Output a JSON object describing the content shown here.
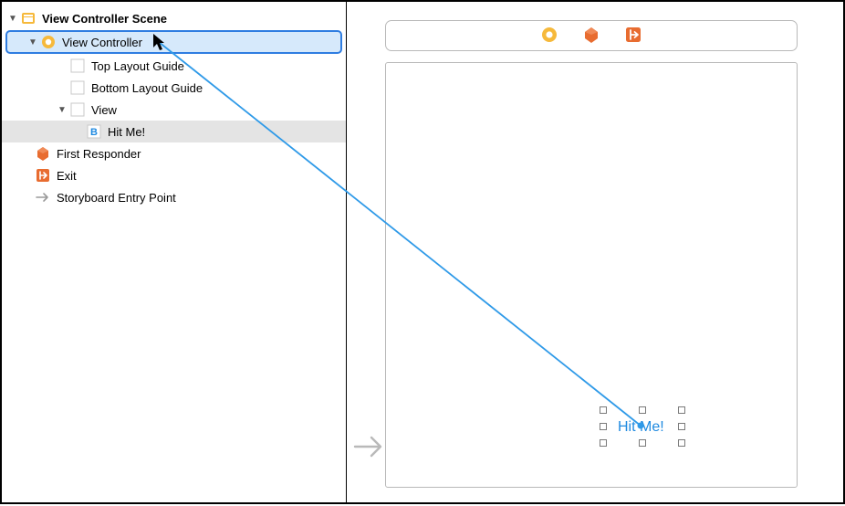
{
  "outline": {
    "scene": {
      "label": "View Controller Scene"
    },
    "viewController": {
      "label": "View Controller"
    },
    "topGuide": {
      "label": "Top Layout Guide"
    },
    "bottomGuide": {
      "label": "Bottom Layout Guide"
    },
    "view": {
      "label": "View"
    },
    "button": {
      "label": "Hit Me!",
      "glyph": "B"
    },
    "firstResponder": {
      "label": "First Responder"
    },
    "exit": {
      "label": "Exit"
    },
    "entryPoint": {
      "label": "Storyboard Entry Point"
    }
  },
  "canvas": {
    "buttonLabel": "Hit Me!"
  },
  "colors": {
    "selectionBorder": "#2f7de1",
    "selectionFill": "#d6e9fb",
    "yellow": "#f6b93b",
    "orange": "#e86c30",
    "orangeAlt": "#e86c30",
    "blue": "#1f8ae0",
    "gray": "#b9b9b9"
  }
}
